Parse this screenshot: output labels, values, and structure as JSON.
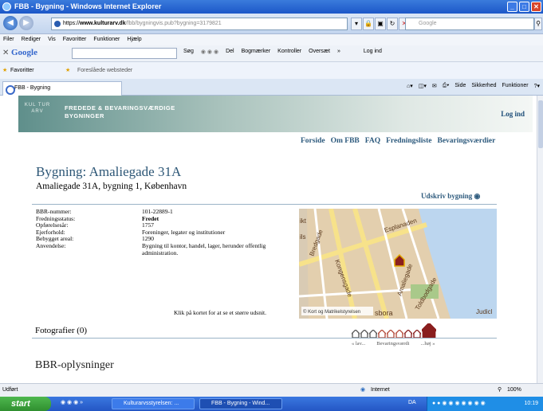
{
  "window": {
    "title": "FBB - Bygning - Windows Internet Explorer"
  },
  "address": {
    "url_prefix": "https://",
    "url_host": "www.kulturarv.dk",
    "url_path": "/fbb/bygningvis.pub?bygning=3179821",
    "search_placeholder": "Google"
  },
  "menu": [
    "Filer",
    "Rediger",
    "Vis",
    "Favoritter",
    "Funktioner",
    "Hjælp"
  ],
  "google_bar": {
    "logo": "Google",
    "items": [
      "Søg",
      "Del",
      "Bogmærker",
      "Kontroller",
      "Oversæt",
      "»",
      "Log ind"
    ]
  },
  "favorites": {
    "label": "Favoritter",
    "suggested": "Foreslåede websteder"
  },
  "tab": {
    "title": "FBB - Bygning",
    "tools": [
      "Side",
      "Sikkerhed",
      "Funktioner"
    ]
  },
  "banner": {
    "mark": "KUL TUR ARV",
    "title_line1": "FREDEDE & BEVARINGSVÆRDIGE",
    "title_line2": "BYGNINGER",
    "login": "Log ind"
  },
  "nav": [
    "Forside",
    "Om FBB",
    "FAQ",
    "Fredningsliste",
    "Bevaringsværdier"
  ],
  "page": {
    "heading": "Bygning: Amaliegade 31A",
    "subheading": "Amaliegade 31A, bygning 1, København",
    "print": "Udskriv bygning"
  },
  "info": [
    {
      "k": "BBR-nummer:",
      "v": "101-22889-1",
      "bold": false
    },
    {
      "k": "Fredningsstatus:",
      "v": "Fredet",
      "bold": true
    },
    {
      "k": "Opførelsesår:",
      "v": "1757",
      "bold": false
    },
    {
      "k": "Ejerforhold:",
      "v": "Foreninger, legater og institutioner",
      "bold": false
    },
    {
      "k": "Bebygget areal:",
      "v": "1290",
      "bold": false
    },
    {
      "k": "Anvendelse:",
      "v": "Bygning til kontor, handel, lager, herunder offentlig administration.",
      "bold": false
    }
  ],
  "map": {
    "note": "Klik på kortet for at se et større udsnit.",
    "copyright": "© Kort og Matrikelstyrelsen",
    "streets": [
      "Esplanaden",
      "Amaliegade",
      "Bredgade",
      "Kongensgade",
      "Toldbodgade",
      "Judicl",
      "sbora",
      "ikt",
      "ils"
    ]
  },
  "photos": {
    "label": "Fotografier (0)"
  },
  "bevaring": {
    "low": "« lav...",
    "mid": "Bevaringsværdi",
    "high": "...høj »",
    "level": 9,
    "max": 9
  },
  "bbr": {
    "heading": "BBR-oplysninger"
  },
  "status": {
    "left": "Udført",
    "zone": "Internet",
    "zoom": "100%"
  },
  "taskbar": {
    "start": "start",
    "tasks": [
      "Kulturarvsstyrelsen: ...",
      "FBB - Bygning - Wind..."
    ],
    "lang": "DA",
    "clock": "10:19"
  }
}
